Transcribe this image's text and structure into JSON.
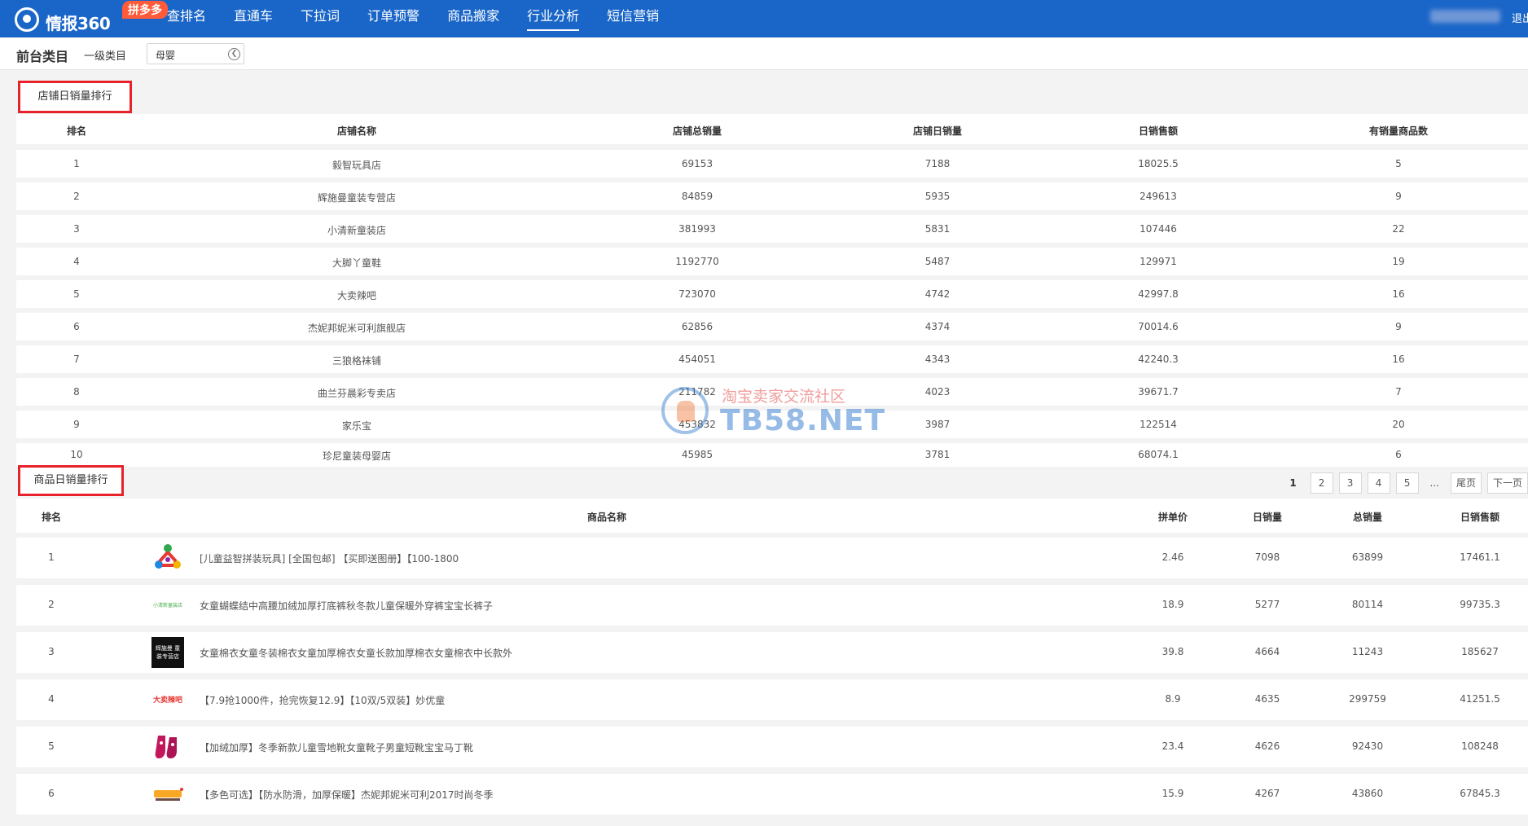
{
  "app": {
    "logo_text": "情报360",
    "logo_badge": "拼多多",
    "logout": "退出"
  },
  "nav": [
    {
      "label": "查排名",
      "active": false
    },
    {
      "label": "直通车",
      "active": false
    },
    {
      "label": "下拉词",
      "active": false
    },
    {
      "label": "订单预警",
      "active": false
    },
    {
      "label": "商品搬家",
      "active": false
    },
    {
      "label": "行业分析",
      "active": true
    },
    {
      "label": "短信营销",
      "active": false
    }
  ],
  "category": {
    "title": "前台类目",
    "level_label": "一级类目",
    "selected": "母婴"
  },
  "store_section": {
    "title": "店铺日销量排行",
    "headers": [
      "排名",
      "店铺名称",
      "店铺总销量",
      "店铺日销量",
      "日销售额",
      "有销量商品数"
    ],
    "rows": [
      [
        "1",
        "毅智玩具店",
        "69153",
        "7188",
        "18025.5",
        "5"
      ],
      [
        "2",
        "辉施曼童装专营店",
        "84859",
        "5935",
        "249613",
        "9"
      ],
      [
        "3",
        "小清新童装店",
        "381993",
        "5831",
        "107446",
        "22"
      ],
      [
        "4",
        "大脚丫童鞋",
        "1192770",
        "5487",
        "129971",
        "19"
      ],
      [
        "5",
        "大卖辣吧",
        "723070",
        "4742",
        "42997.8",
        "16"
      ],
      [
        "6",
        "杰妮邦妮米可利旗舰店",
        "62856",
        "4374",
        "70014.6",
        "9"
      ],
      [
        "7",
        "三狼格袜铺",
        "454051",
        "4343",
        "42240.3",
        "16"
      ],
      [
        "8",
        "曲兰芬晨彩专卖店",
        "211782",
        "4023",
        "39671.7",
        "7"
      ],
      [
        "9",
        "家乐宝",
        "453832",
        "3987",
        "122514",
        "20"
      ],
      [
        "10",
        "珍尼童装母婴店",
        "45985",
        "3781",
        "68074.1",
        "6"
      ]
    ]
  },
  "pagination": {
    "current": "1",
    "pages": [
      "2",
      "3",
      "4",
      "5"
    ],
    "ellipsis": "...",
    "last": "尾页",
    "next": "下一页"
  },
  "goods_section": {
    "title": "商品日销量排行",
    "headers": [
      "排名",
      "商品名称",
      "拼单价",
      "日销量",
      "总销量",
      "日销售额"
    ],
    "rows": [
      {
        "rank": "1",
        "name": "[儿童益智拼装玩具] [全国包邮] 【买即送图册】【100-1800",
        "price": "2.46",
        "daily": "7098",
        "total": "63899",
        "revenue": "17461.1",
        "thumb": "puzzle-toy"
      },
      {
        "rank": "2",
        "name": "女童蝴蝶结中高腰加绒加厚打底裤秋冬款儿童保暖外穿裤宝宝长裤子",
        "price": "18.9",
        "daily": "5277",
        "total": "80114",
        "revenue": "99735.3",
        "thumb": "store-logo",
        "thumb_text": "小清新童装店"
      },
      {
        "rank": "3",
        "name": "女童棉衣女童冬装棉衣女童加厚棉衣女童长款加厚棉衣女童棉衣中长款外",
        "price": "39.8",
        "daily": "4664",
        "total": "11243",
        "revenue": "185627",
        "thumb": "black-logo",
        "thumb_text": "辉施曼 童装专营店"
      },
      {
        "rank": "4",
        "name": "【7.9抢1000件，抢完恢复12.9】【10双/5双装】妙优童",
        "price": "8.9",
        "daily": "4635",
        "total": "299759",
        "revenue": "41251.5",
        "thumb": "dalaba-logo",
        "thumb_text": "大卖辣吧"
      },
      {
        "rank": "5",
        "name": "【加绒加厚】冬季新款儿童雪地靴女童靴子男童短靴宝宝马丁靴",
        "price": "23.4",
        "daily": "4626",
        "total": "92430",
        "revenue": "108248",
        "thumb": "boots"
      },
      {
        "rank": "6",
        "name": "【多色可选】【防水防滑，加厚保暖】杰妮邦妮米可利2017时尚冬季",
        "price": "15.9",
        "daily": "4267",
        "total": "43860",
        "revenue": "67845.3",
        "thumb": "brand-logo"
      }
    ]
  },
  "watermark": {
    "cn": "淘宝卖家交流社区",
    "en": "TB58.NET"
  },
  "colors": {
    "topbar": "#1a66c8",
    "highlight_border": "#e8222a",
    "badge": "#ff5a3a"
  }
}
